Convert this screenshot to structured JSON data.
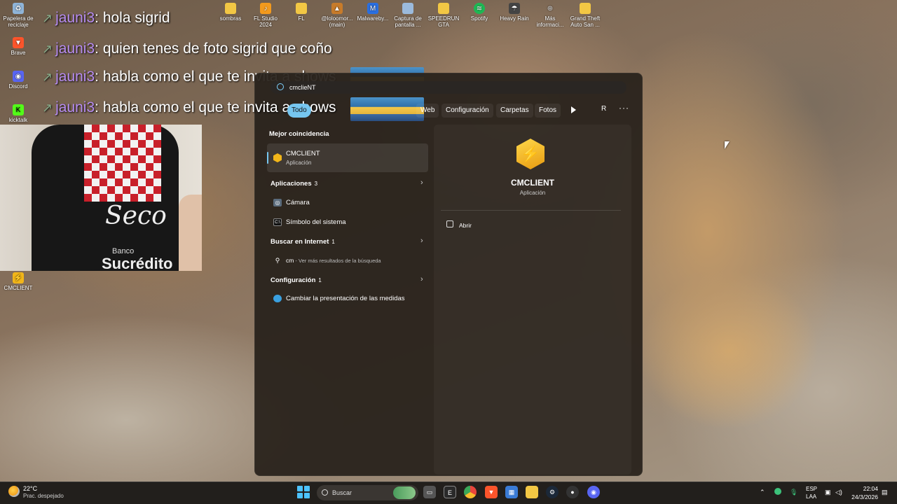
{
  "desktop_icons": [
    {
      "label": "Papelera de reciclaje",
      "icon": "recycle-bin-icon",
      "color": "#8fb4d8"
    },
    {
      "label": "Brave",
      "icon": "brave-icon",
      "color": "#fb542b"
    },
    {
      "label": "Discord",
      "icon": "discord-icon",
      "color": "#5865f2"
    },
    {
      "label": "kicktalk",
      "icon": "kicktalk-icon",
      "color": "#53fc18"
    },
    {
      "label": "CMCLIENT",
      "icon": "cmclient-icon",
      "color": "#f2b619"
    },
    {
      "label": "sombras",
      "icon": "folder-icon",
      "color": "#f2c744"
    },
    {
      "label": "FL Studio 2024",
      "icon": "fl-studio-icon",
      "color": "#f39a1d"
    },
    {
      "label": "FL",
      "icon": "folder-icon",
      "color": "#f2c744"
    },
    {
      "label": "@loloomor... (main)",
      "icon": "game-icon",
      "color": "#c77b2a"
    },
    {
      "label": "Malwareby...",
      "icon": "malwarebytes-icon",
      "color": "#2a6fe0"
    },
    {
      "label": "Captura de pantalla ...",
      "icon": "image-file-icon",
      "color": "#9bbadc"
    },
    {
      "label": "SPEEDRUN GTA",
      "icon": "folder-icon",
      "color": "#f2c744"
    },
    {
      "label": "Spotify",
      "icon": "spotify-icon",
      "color": "#1db954"
    },
    {
      "label": "Heavy Rain",
      "icon": "heavy-rain-icon",
      "color": "#444444"
    },
    {
      "label": "Más informaci...",
      "icon": "info-icon",
      "color": "#cccccc"
    },
    {
      "label": "Grand Theft Auto San ...",
      "icon": "folder-icon",
      "color": "#f2c744"
    }
  ],
  "chat": {
    "lines": [
      {
        "user": "jauni3",
        "message": ": hola sigrid"
      },
      {
        "user": "jauni3",
        "message": ": quien tenes de foto sigrid que coño"
      },
      {
        "user": "jauni3",
        "message": ": habla como el que te invita a shows"
      },
      {
        "user": "jauni3",
        "message": ": habla como el que te invita a shows"
      }
    ]
  },
  "webcam": {
    "logo": "Seco",
    "sponsor_top": "Banco",
    "sponsor_bottom": "Sucrédito"
  },
  "search": {
    "query": "cmclieNT",
    "filters": [
      "Todo",
      "Web",
      "Configuración",
      "Carpetas",
      "Fotos"
    ],
    "user_initial": "R",
    "more": "···",
    "best_match_title": "Mejor coincidencia",
    "best_match": {
      "name": "CMCLIENT",
      "type": "Aplicación"
    },
    "sections": {
      "apps": {
        "title": "Aplicaciones",
        "count": "3",
        "items": [
          "Cámara",
          "Símbolo del sistema"
        ]
      },
      "web": {
        "title": "Buscar en Internet",
        "count": "1",
        "query": "cm",
        "hint": " - Ver más resultados de la búsqueda"
      },
      "settings": {
        "title": "Configuración",
        "count": "1",
        "items": [
          "Cambiar la presentación de las medidas"
        ]
      }
    },
    "detail": {
      "name": "CMCLIENT",
      "type": "Aplicación",
      "action": "Abrir"
    }
  },
  "taskbar": {
    "weather": {
      "temp": "22°C",
      "desc": "Prac. despejado"
    },
    "search_label": "Buscar",
    "apps": [
      {
        "name": "task-view-icon",
        "color": "#555555"
      },
      {
        "name": "epic-games-icon",
        "color": "#2a2a2a"
      },
      {
        "name": "chrome-icon",
        "color": "#e8453c"
      },
      {
        "name": "brave-icon",
        "color": "#fb542b"
      },
      {
        "name": "store-icon",
        "color": "#3a7bd5"
      },
      {
        "name": "file-explorer-icon",
        "color": "#f2c744"
      },
      {
        "name": "steam-icon",
        "color": "#1b2838"
      },
      {
        "name": "github-icon",
        "color": "#333333"
      },
      {
        "name": "discord-icon",
        "color": "#5865f2"
      }
    ],
    "tray": {
      "lang1": "ESP",
      "lang2": "LAA",
      "time": "22:04",
      "date": "24/3/2026"
    }
  },
  "colors": {
    "accent": "#76c6f0",
    "panel": "#28221c",
    "chat_user": "#b78cf0"
  }
}
